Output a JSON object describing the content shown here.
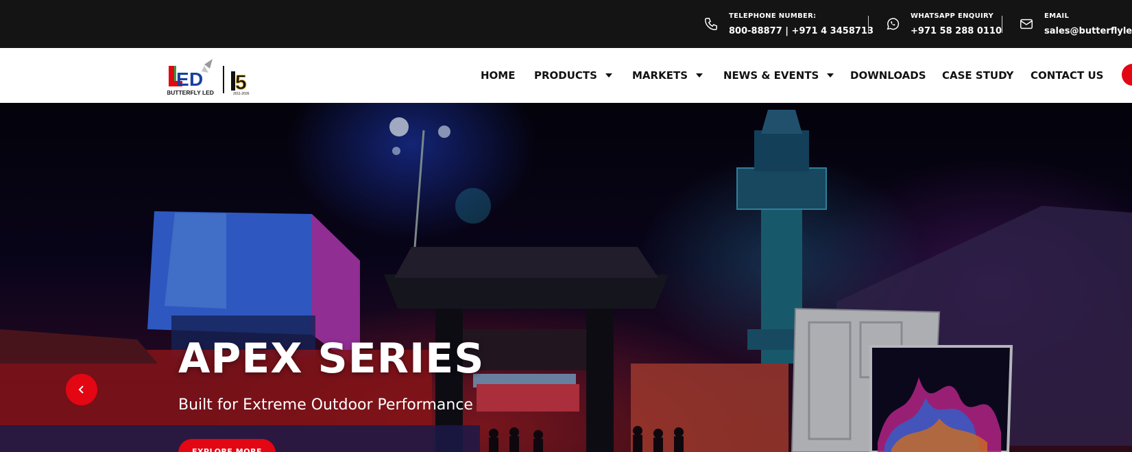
{
  "topbar": {
    "telephone": {
      "label": "TELEPHONE NUMBER:",
      "value": "800-88877 | +971 4 3458713",
      "icon": "phone-icon"
    },
    "whatsapp": {
      "label": "WHATSAPP ENQUIRY",
      "value": "+971 58 288 0110",
      "icon": "whatsapp-icon"
    },
    "email": {
      "label": "EMAIL",
      "value": "sales@butterflyled.com",
      "icon": "mail-icon"
    }
  },
  "logo": {
    "brand": "BUTTERFLY LED",
    "mark": "LED",
    "anniversary": "15",
    "years": "2011-2026"
  },
  "nav": {
    "items": [
      {
        "label": "HOME",
        "dropdown": false
      },
      {
        "label": "PRODUCTS",
        "dropdown": true
      },
      {
        "label": "MARKETS",
        "dropdown": true
      },
      {
        "label": "NEWS & EVENTS",
        "dropdown": true
      },
      {
        "label": "DOWNLOADS",
        "dropdown": false
      },
      {
        "label": "CASE STUDY",
        "dropdown": false
      },
      {
        "label": "CONTACT US",
        "dropdown": false
      }
    ]
  },
  "hero": {
    "title": "APEX SERIES",
    "subtitle": "Built for Extreme Outdoor Performance",
    "cta_label": "EXPLORE MORE"
  },
  "colors": {
    "accent": "#e30613",
    "topbar_bg": "#141414",
    "header_bg": "#ffffff"
  }
}
